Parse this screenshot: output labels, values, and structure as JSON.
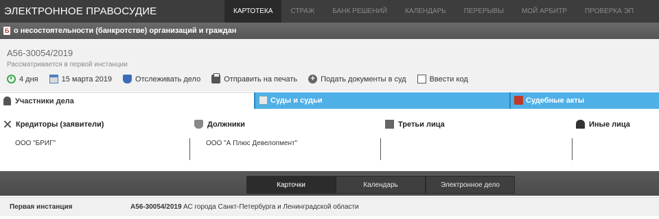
{
  "app": {
    "title": "ЭЛЕКТРОННОЕ ПРАВОСУДИЕ"
  },
  "topnav": [
    {
      "label": "КАРТОТЕКА",
      "active": true
    },
    {
      "label": "СТРАЖ",
      "active": false
    },
    {
      "label": "БАНК РЕШЕНИЙ",
      "active": false
    },
    {
      "label": "КАЛЕНДАРЬ",
      "active": false
    },
    {
      "label": "ПЕРЕРЫВЫ",
      "active": false
    },
    {
      "label": "МОЙ АРБИТР",
      "active": false
    },
    {
      "label": "ПРОВЕРКА ЭП",
      "active": false
    }
  ],
  "case": {
    "badge": "Б",
    "type": "о несостоятельности (банкротстве) организаций и граждан",
    "number": "А56-30054/2019",
    "status": "Рассматривается в первой инстанции"
  },
  "actions": {
    "duration": "4 дня",
    "date": "15 марта 2019",
    "track": "Отслеживать дело",
    "print": "Отправить на печать",
    "submit": "Подать документы в суд",
    "code": "Ввести код"
  },
  "tabs": {
    "participants": "Участники дела",
    "courts": "Суды и судьи",
    "acts": "Судебные акты"
  },
  "parties": {
    "creditors": {
      "title": "Кредиторы (заявители)",
      "name": "ООО \"БРИГ\""
    },
    "debtors": {
      "title": "Должники",
      "name": "ООО \"А Плюс Девелопмент\""
    },
    "third": {
      "title": "Третьи лица",
      "name": ""
    },
    "other": {
      "title": "Иные лица",
      "name": ""
    }
  },
  "bottom_tabs": {
    "cards": "Карточки",
    "calendar": "Календарь",
    "edelo": "Электронное дело"
  },
  "instance": {
    "label": "Первая инстанция",
    "number": "А56-30054/2019",
    "court": "АС города Санкт-Петербурга и Ленинградской области"
  },
  "colors": {
    "tab_blue": "#4fb0e8",
    "topbar": "#3d3d3d"
  }
}
